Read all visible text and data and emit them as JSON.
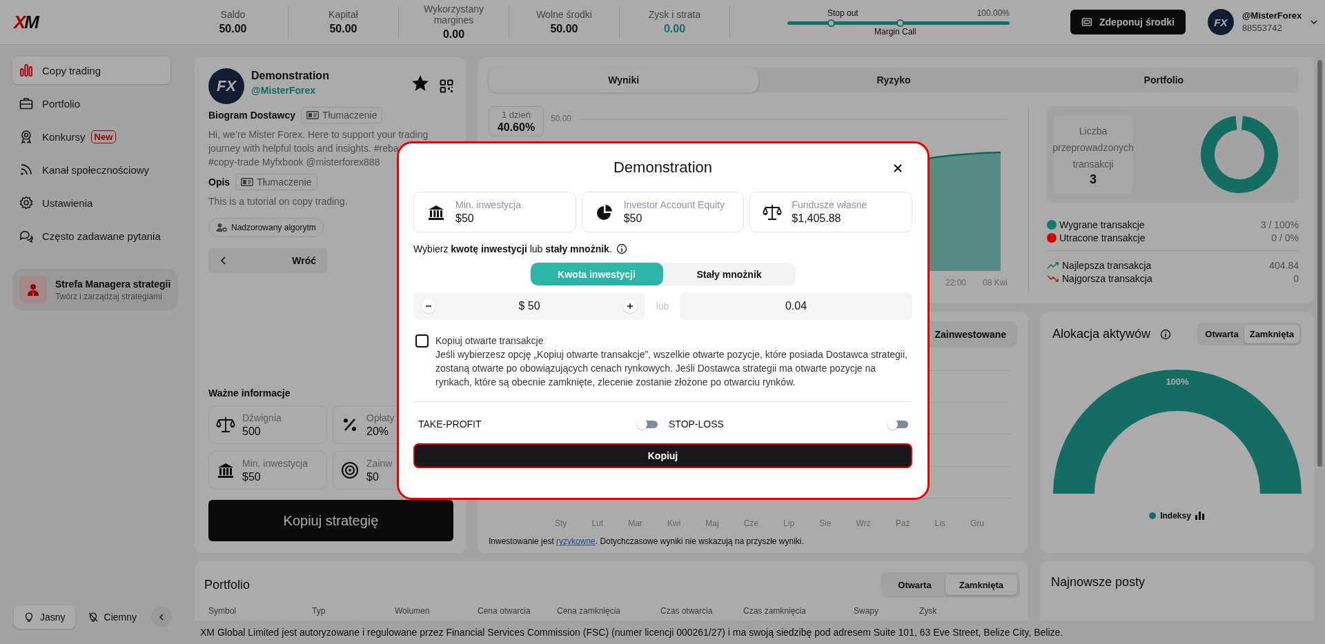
{
  "topbar": {
    "logo": "XM",
    "stats": [
      {
        "label": "Saldo",
        "value": "50.00",
        "kind": "plain"
      },
      {
        "label": "Kapitał",
        "value": "50.00",
        "kind": "plain"
      },
      {
        "label": "Wykorzystany margines",
        "value": "0.00",
        "kind": "plain"
      },
      {
        "label": "Wolne środki",
        "value": "50.00",
        "kind": "plain"
      },
      {
        "label": "Zysk i strata",
        "value": "0.00",
        "kind": "profit"
      }
    ],
    "margin_gauge": {
      "stop_out": "Stop out",
      "max": "100.00%",
      "margin_call": "Margin Call"
    },
    "deposit_button": "Zdeponuj środki",
    "account": {
      "avatar_text": "FX",
      "name": "@MisterForex",
      "number": "88553742"
    }
  },
  "sidebar": {
    "items": [
      {
        "label": "Copy trading",
        "selected": true
      },
      {
        "label": "Portfolio",
        "selected": false
      },
      {
        "label": "Konkursy",
        "selected": false,
        "badge": "New"
      },
      {
        "label": "Kanał społecznościowy",
        "selected": false
      },
      {
        "label": "Ustawienia",
        "selected": false
      },
      {
        "label": "Często zadawane pytania",
        "selected": false
      }
    ],
    "manager": {
      "title": "Strefa Managera strategii",
      "subtitle": "Twórz i zarządzaj strategiami"
    },
    "themes": [
      {
        "label": "Jasny",
        "selected": true
      },
      {
        "label": "Ciemny",
        "selected": false
      }
    ]
  },
  "provider": {
    "avatar_text": "FX",
    "name": "Demonstration",
    "handle": "@MisterForex",
    "favorite": true,
    "bio_label": "Biogram Dostawcy",
    "bio_translate": "Tłumaczenie",
    "bio_lines": [
      "Hi, we’re Mister Forex. Here to support your trading",
      "journey with helpful tools and insights. #reba",
      "#copy-trade Myfxbook @misterforex888"
    ],
    "description_label": "Opis",
    "description_translate": "Tłumaczenie",
    "description": "This is a tutorial on copy trading.",
    "tag": "Nadzorowany algorytm",
    "back_button": "Wróć",
    "info_title": "Ważne informacje",
    "info_cards": [
      {
        "label": "Dźwignia",
        "value": "500"
      },
      {
        "label": "Opłaty",
        "value": "20%"
      },
      {
        "label": "Min. inwestycja",
        "value": "$50"
      },
      {
        "label": "Zainw",
        "value": "$0"
      }
    ],
    "copy_button": "Kopiuj strategię"
  },
  "performance": {
    "tabs": [
      {
        "label": "Wyniki",
        "selected": true
      },
      {
        "label": "Ryzyko",
        "selected": false
      },
      {
        "label": "Portfolio",
        "selected": false
      }
    ],
    "period": {
      "label": "1 dzień",
      "value": "40.60%"
    },
    "y_tick": "50.00",
    "x_labels": [
      "22:00",
      "08 Kwi"
    ],
    "trades": {
      "label": "Liczba przeprowadzonych transakcji",
      "count": "3"
    },
    "legend": [
      {
        "kind": "dot",
        "color": "#157a6c",
        "label": "Wygrane transakcje",
        "value": "3 / 100%"
      },
      {
        "kind": "dot",
        "color": "#d40000",
        "label": "Utracone transakcje",
        "value": "0 / 0%"
      },
      {
        "kind": "up",
        "label": "Najlepsza transakcja",
        "value": "404.84"
      },
      {
        "kind": "down",
        "label": "Najgorsza transakcja",
        "value": "0"
      }
    ]
  },
  "investments": {
    "tab": "Zainwestowane",
    "months": [
      "Sty",
      "Lut",
      "Mar",
      "Kwi",
      "Maj",
      "Cze",
      "Lip",
      "Sie",
      "Wrz",
      "Paź",
      "Lis",
      "Gru"
    ],
    "disclaimer": {
      "before": "Inwestowanie jest ",
      "link": "ryzykowne",
      "after": ". Dotychczasowe wyniki nie wskazują na przyszłe wyniki."
    }
  },
  "allocation": {
    "title": "Alokacja aktywów",
    "tabs": [
      {
        "label": "Otwarta",
        "selected": false
      },
      {
        "label": "Zamknięta",
        "selected": true
      }
    ],
    "chart_data": {
      "type": "pie",
      "categories": [
        "Indeksy"
      ],
      "values": [
        100
      ],
      "value_labels": [
        "100%"
      ]
    }
  },
  "portfolio": {
    "title": "Portfolio",
    "tabs": [
      {
        "label": "Otwarta",
        "selected": false
      },
      {
        "label": "Zamknięta",
        "selected": true
      }
    ],
    "columns": [
      "Symbol",
      "Typ",
      "Wolumen",
      "Cena otwarcia",
      "Cena zamknięcia",
      "Czas otwarcia",
      "Czas zamknięcia",
      "Swapy",
      "Zysk"
    ]
  },
  "posts": {
    "title": "Najnowsze posty"
  },
  "footer": "XM Global Limited jest autoryzowane i regulowane przez Financial Services Commission (FSC) (numer licencji 000261/27) i ma swoją siedzibę pod adresem Suite 101, 63 Eve Street, Belize City, Belize.",
  "modal": {
    "title": "Demonstration",
    "cards": [
      {
        "label": "Min. inwestycja",
        "value": "$50"
      },
      {
        "label": "Investor Account Equity",
        "value": "$50"
      },
      {
        "label": "Fundusze własne",
        "value": "$1,405.88"
      }
    ],
    "prompt": "Wybierz **kwotę inwestycji** lub **stały mnożnik**.",
    "modes": [
      {
        "label": "Kwota inwestycji",
        "selected": true
      },
      {
        "label": "Stały mnożnik",
        "selected": false
      }
    ],
    "amount": "$ 50",
    "or": "lub",
    "multiplier": "0.04",
    "copy_open": {
      "checked": false,
      "label": "Kopiuj otwarte transakcje",
      "description": "Jeśli wybierzesz opcję „Kopiuj otwarte transakcje”, wszelkie otwarte pozycje, które posiada Dostawca strategii, zostaną otwarte po obowiązujących cenach rynkowych. Jeśli Dostawca strategii ma otwarte pozycje na rynkach, które są obecnie zamknięte, zlecenie zostanie złożone po otwarciu rynków."
    },
    "toggles": [
      {
        "label": "TAKE-PROFIT",
        "on": false
      },
      {
        "label": "STOP-LOSS",
        "on": false
      }
    ],
    "submit": "Kopiuj"
  }
}
